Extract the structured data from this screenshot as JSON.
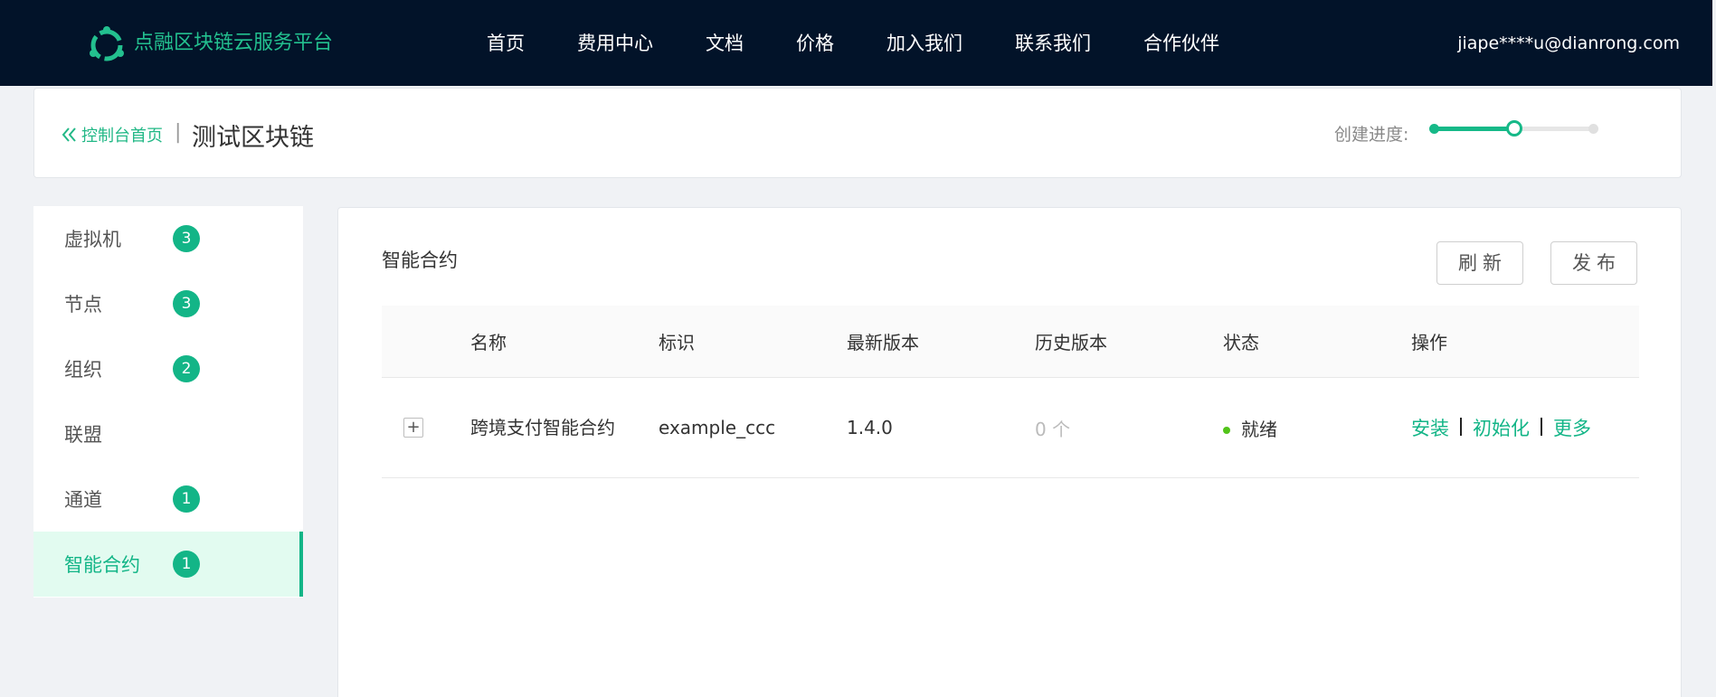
{
  "brand": {
    "name": "点融区块链云服务平台",
    "accent_color": "#23c08f",
    "logo_icon": "dianrong-logo-icon"
  },
  "nav": {
    "items": [
      "首页",
      "费用中心",
      "文档",
      "价格",
      "加入我们",
      "联系我们",
      "合作伙伴"
    ]
  },
  "user": {
    "email": "jiape****u@dianrong.com"
  },
  "header": {
    "back_label": "控制台首页",
    "back_icon": "double-chevron-left-icon",
    "separator": "|",
    "title": "测试区块链",
    "progress_label": "创建进度:",
    "progress_fraction": 0.5
  },
  "sidebar": {
    "items": [
      {
        "label": "虚拟机",
        "badge": "3"
      },
      {
        "label": "节点",
        "badge": "3"
      },
      {
        "label": "组织",
        "badge": "2"
      },
      {
        "label": "联盟",
        "badge": ""
      },
      {
        "label": "通道",
        "badge": "1"
      },
      {
        "label": "智能合约",
        "badge": "1",
        "active": true
      }
    ]
  },
  "main": {
    "section_title": "智能合约",
    "refresh_label": "刷新",
    "publish_label": "发布",
    "table": {
      "columns": [
        "名称",
        "标识",
        "最新版本",
        "历史版本",
        "状态",
        "操作"
      ],
      "rows": [
        {
          "expand": "+",
          "name": "跨境支付智能合约",
          "id": "example_ccc",
          "latest_version": "1.4.0",
          "history_versions": "0 个",
          "status": "就绪",
          "status_color": "#52c41a",
          "ops": [
            "安装",
            "初始化",
            "更多"
          ]
        }
      ]
    }
  }
}
